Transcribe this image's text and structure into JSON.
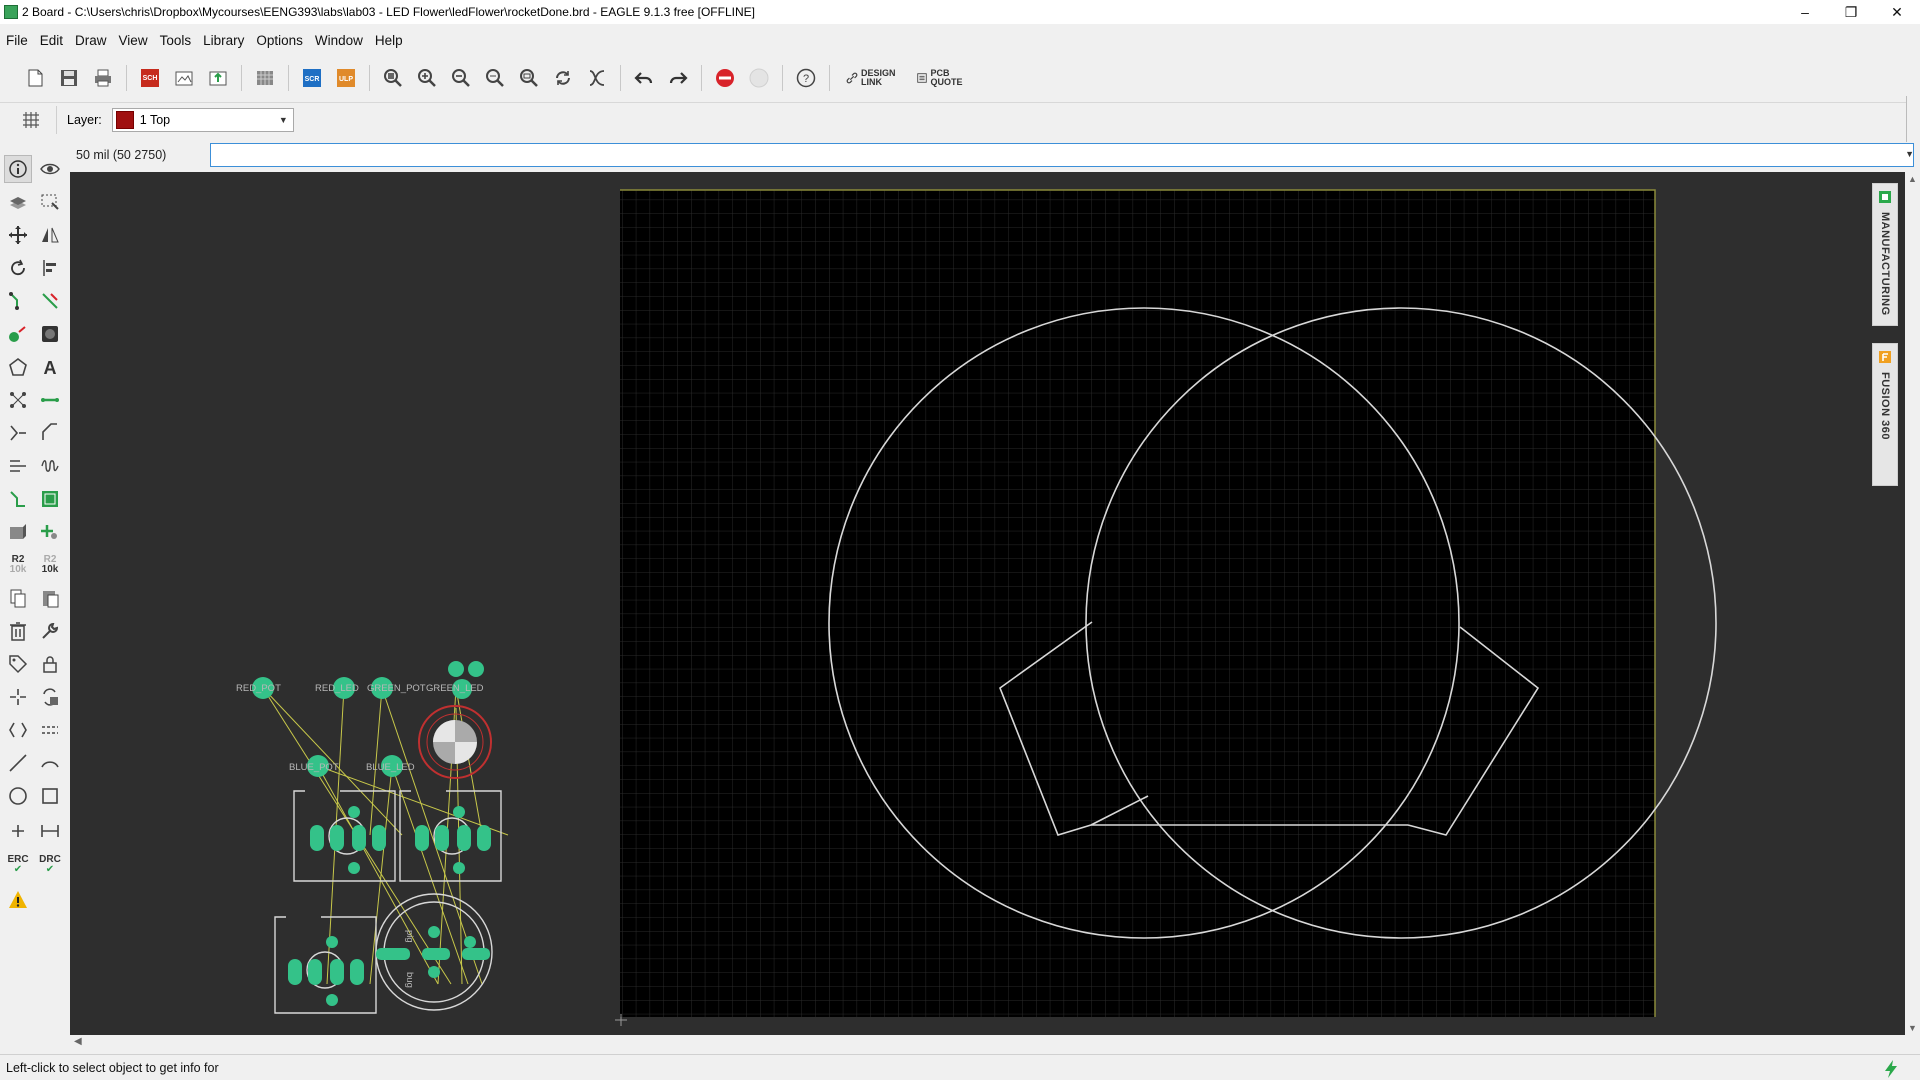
{
  "window": {
    "title": "2 Board - C:\\Users\\chris\\Dropbox\\Mycourses\\EENG393\\labs\\lab03 - LED Flower\\ledFlower\\rocketDone.brd - EAGLE 9.1.3 free [OFFLINE]",
    "controls": [
      "minimize",
      "restore",
      "close"
    ]
  },
  "menu": [
    "File",
    "Edit",
    "Draw",
    "View",
    "Tools",
    "Library",
    "Options",
    "Window",
    "Help"
  ],
  "toolbar": {
    "sch_label": "SCH",
    "scr_label": "SCR",
    "ulp_label": "ULP",
    "design_link": [
      "DESIGN",
      "LINK"
    ],
    "pcb_quote": [
      "PCB",
      "QUOTE"
    ]
  },
  "params": {
    "layer_label": "Layer:",
    "layer_value": "1 Top",
    "layer_color": "#a01010"
  },
  "command": {
    "coords": "50 mil (50 2750)",
    "value": ""
  },
  "tools": {
    "r2_top": "R2",
    "r2_bottom": "10k",
    "r2b_top": "R2",
    "r2b_bottom": "10k",
    "erc": "ERC",
    "drc": "DRC"
  },
  "side_panels": [
    "MANUFACTURING",
    "FUSION 360"
  ],
  "board": {
    "part_labels": [
      "RED_POT",
      "RED_LED",
      "GREEN_POT",
      "GREEN_LED",
      "BLUE_POT",
      "BLUE_LED"
    ],
    "pin_labels": [
      "pig",
      "bug"
    ]
  },
  "status": {
    "message": "Left-click to select object to get info for"
  },
  "colors": {
    "canvas_bg": "#2e2e2e",
    "board_bg": "#000000",
    "pad_green": "#34c289",
    "airwire": "#c8c84a",
    "dimension": "#d8d8d8",
    "border_yellow": "#8a8a3a"
  }
}
